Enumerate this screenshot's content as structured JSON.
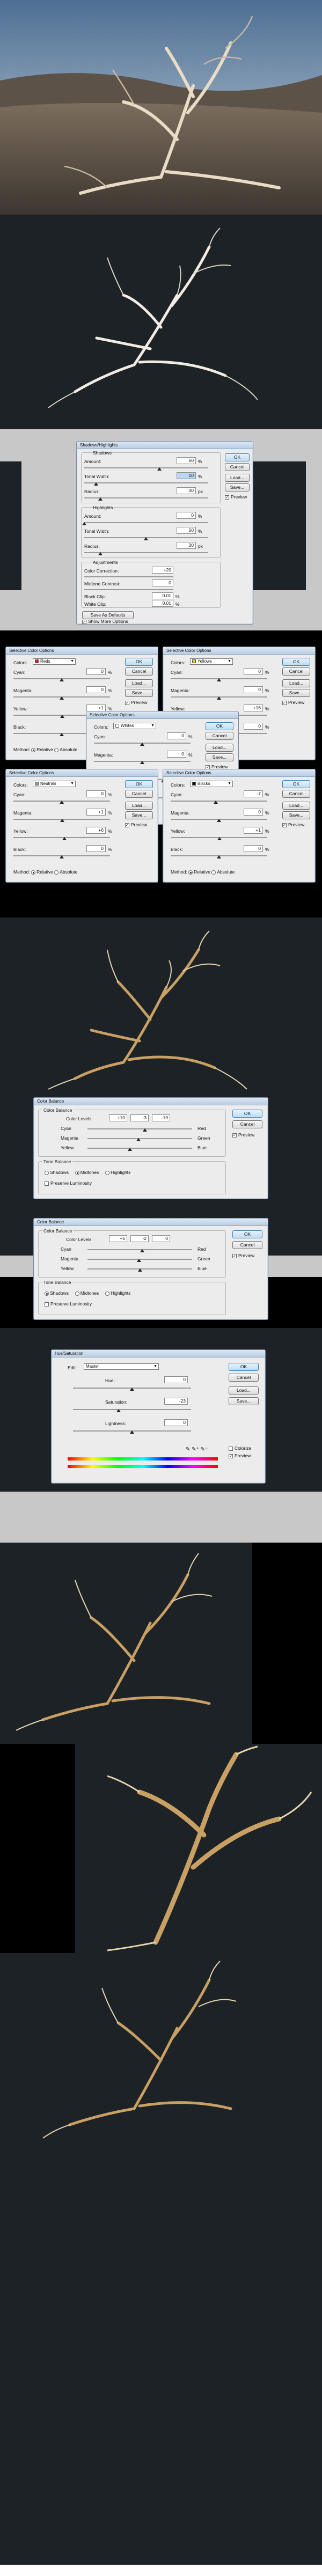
{
  "shadows_highlights": {
    "title": "Shadows/Highlights",
    "shadows_label": "Shadows",
    "amount_label": "Amount:",
    "amount": "60",
    "pct": "%",
    "tonal_label": "Tonal Width:",
    "tonal": "10",
    "radius_label": "Radius:",
    "radius": "30",
    "px": "px",
    "highlights_label": "Highlights",
    "h_amount": "0",
    "h_tonal": "50",
    "h_radius": "30",
    "adjustments_label": "Adjustments",
    "color_corr_label": "Color Correction:",
    "color_corr": "+20",
    "midtone_label": "Midtone Contrast:",
    "midtone": "0",
    "black_clip_label": "Black Clip:",
    "black_clip": "0.01",
    "white_clip_label": "White Clip:",
    "white_clip": "0.01",
    "save_defaults": "Save As Defaults",
    "show_more": "Show More Options",
    "ok": "OK",
    "cancel": "Cancel",
    "load": "Load...",
    "save": "Save...",
    "preview": "Preview"
  },
  "selective_labels": {
    "title": "Selective Color Options",
    "colors": "Colors:",
    "cyan": "Cyan:",
    "magenta": "Magenta:",
    "yellow": "Yellow:",
    "black": "Black:",
    "method": "Method:",
    "relative": "Relative",
    "absolute": "Absolute",
    "ok": "OK",
    "cancel": "Cancel",
    "load": "Load...",
    "save": "Save...",
    "preview": "Preview",
    "pct": "%"
  },
  "selective": [
    {
      "color": "Reds",
      "swatch": "#d81e1e",
      "cyan": "0",
      "magenta": "0",
      "yellow": "+1",
      "black": "0"
    },
    {
      "color": "Yellows",
      "swatch": "#e8d21a",
      "cyan": "0",
      "magenta": "0",
      "yellow": "+16",
      "black": "0"
    },
    {
      "color": "Whites",
      "swatch": "#ffffff",
      "cyan": "0",
      "magenta": "0",
      "yellow": "+43",
      "black": "0"
    },
    {
      "color": "Neutrals",
      "swatch": "#9a9a9a",
      "cyan": "0",
      "magenta": "+1",
      "yellow": "+6",
      "black": "0"
    },
    {
      "color": "Blacks",
      "swatch": "#111111",
      "cyan": "-7",
      "magenta": "0",
      "yellow": "+1",
      "black": "0"
    }
  ],
  "color_balance": {
    "title": "Color Balance",
    "group": "Color Balance",
    "levels_label": "Color Levels:",
    "cyan": "Cyan",
    "red": "Red",
    "magenta": "Magenta",
    "green": "Green",
    "yellow": "Yellow",
    "blue": "Blue",
    "tone_label": "Tone Balance",
    "shadows": "Shadows",
    "midtones": "Midtones",
    "highlights": "Highlights",
    "preserve": "Preserve Luminosity",
    "ok": "OK",
    "cancel": "Cancel",
    "preview": "Preview",
    "first": {
      "l1": "+10",
      "l2": "-3",
      "l3": "-19"
    },
    "second": {
      "l1": "+5",
      "l2": "-2",
      "l3": "0"
    }
  },
  "hue_sat": {
    "title": "Hue/Saturation",
    "edit_label": "Edit:",
    "edit_value": "Master",
    "hue_label": "Hue:",
    "hue": "0",
    "sat_label": "Saturation:",
    "sat": "-23",
    "light_label": "Lightness:",
    "light": "0",
    "colorize": "Colorize",
    "preview": "Preview",
    "ok": "OK",
    "cancel": "Cancel",
    "load": "Load...",
    "save": "Save..."
  },
  "colors": {
    "dark_bg": "#1c2226",
    "gray_bg": "#c8c8c8",
    "black": "#000000",
    "wood": "#c9a063"
  }
}
